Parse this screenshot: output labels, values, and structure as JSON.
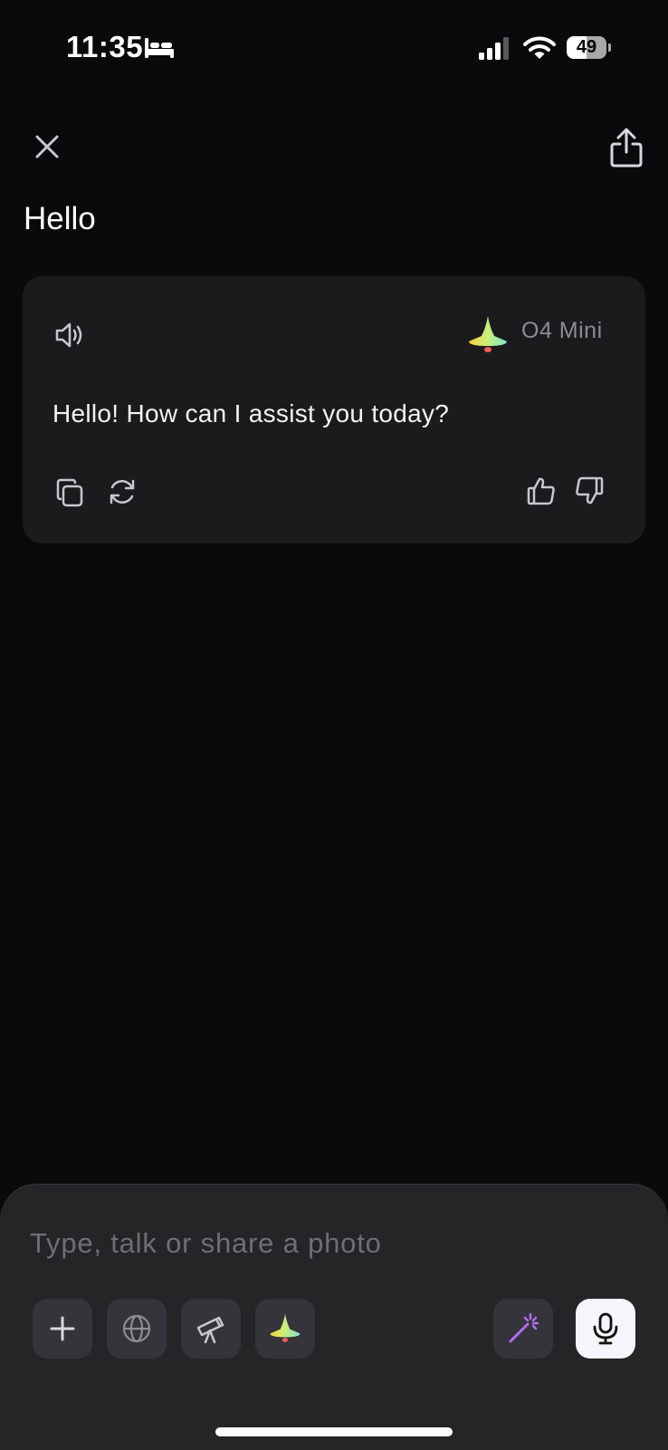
{
  "status_bar": {
    "time": "11:35",
    "battery_level": 49,
    "battery_text": "49",
    "icons": [
      "bed-icon",
      "cellular-signal-icon",
      "wifi-icon",
      "battery-icon"
    ]
  },
  "header": {
    "title": "Hello",
    "icons": [
      "close-icon",
      "share-icon"
    ]
  },
  "message": {
    "model_name": "O4 Mini",
    "text": "Hello! How can I assist you today?",
    "icons": [
      "speaker-icon",
      "model-logo-icon",
      "copy-icon",
      "regenerate-icon",
      "thumbs-up-icon",
      "thumbs-down-icon"
    ]
  },
  "composer": {
    "placeholder": "Type, talk or share a photo",
    "value": "",
    "tools": [
      "plus-icon",
      "globe-icon",
      "telescope-icon",
      "model-logo-icon",
      "magic-wand-icon",
      "microphone-icon"
    ]
  },
  "colors": {
    "background": "#0a0a0c",
    "card": "#1b1b1e",
    "composer": "#252528",
    "tool_button": "#34343a",
    "accent_purple": "#b46cf0",
    "muted_text": "#8c8c91"
  }
}
